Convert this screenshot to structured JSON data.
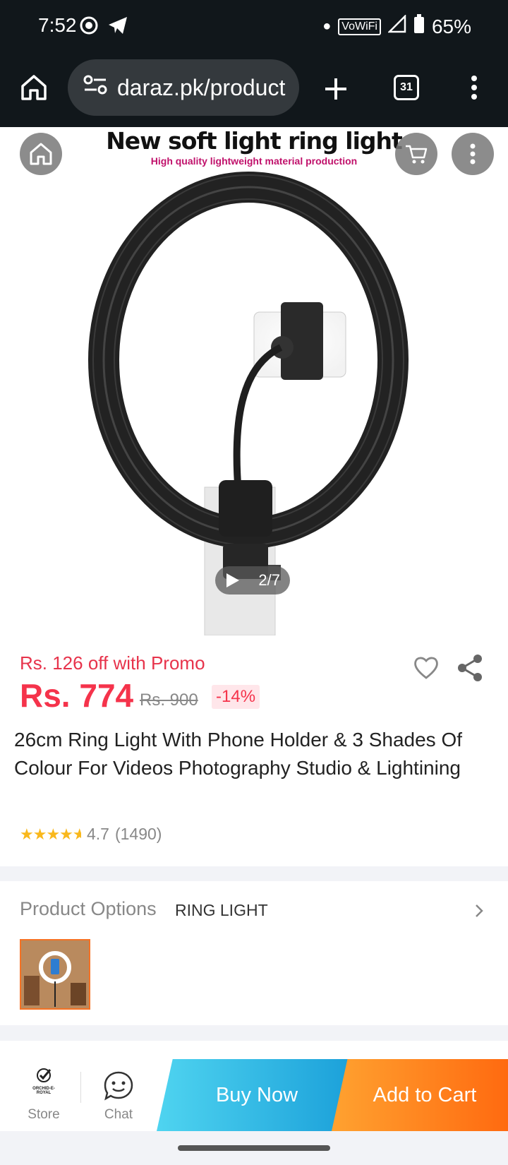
{
  "status": {
    "time": "7:52",
    "network": "VoWiFi",
    "battery": "65%"
  },
  "browser": {
    "url": "daraz.pk/product",
    "tab_count": "31"
  },
  "product_image": {
    "banner_title": "New soft light ring light",
    "banner_subtitle": "High quality lightweight material production",
    "counter": "2/7"
  },
  "product": {
    "promo": "Rs. 126 off with Promo",
    "price": "Rs. 774",
    "old_price": "Rs. 900",
    "discount": "-14%",
    "title": "26cm Ring Light With Phone Holder & 3 Shades Of Colour For Videos Photography Studio & Lightining",
    "rating": "4.7",
    "rating_count": "(1490)",
    "stars": 4.5
  },
  "options": {
    "label": "Product Options",
    "value": "RING LIGHT"
  },
  "bottom": {
    "store_label": "Store",
    "store_logo_text": "ORCHID-E-ROYAL",
    "chat_label": "Chat",
    "buy_now": "Buy Now",
    "add_to_cart": "Add to Cart"
  },
  "colors": {
    "price": "#f5334b",
    "buy_now": "#1a9fd9",
    "add_to_cart": "#ff6a10"
  }
}
